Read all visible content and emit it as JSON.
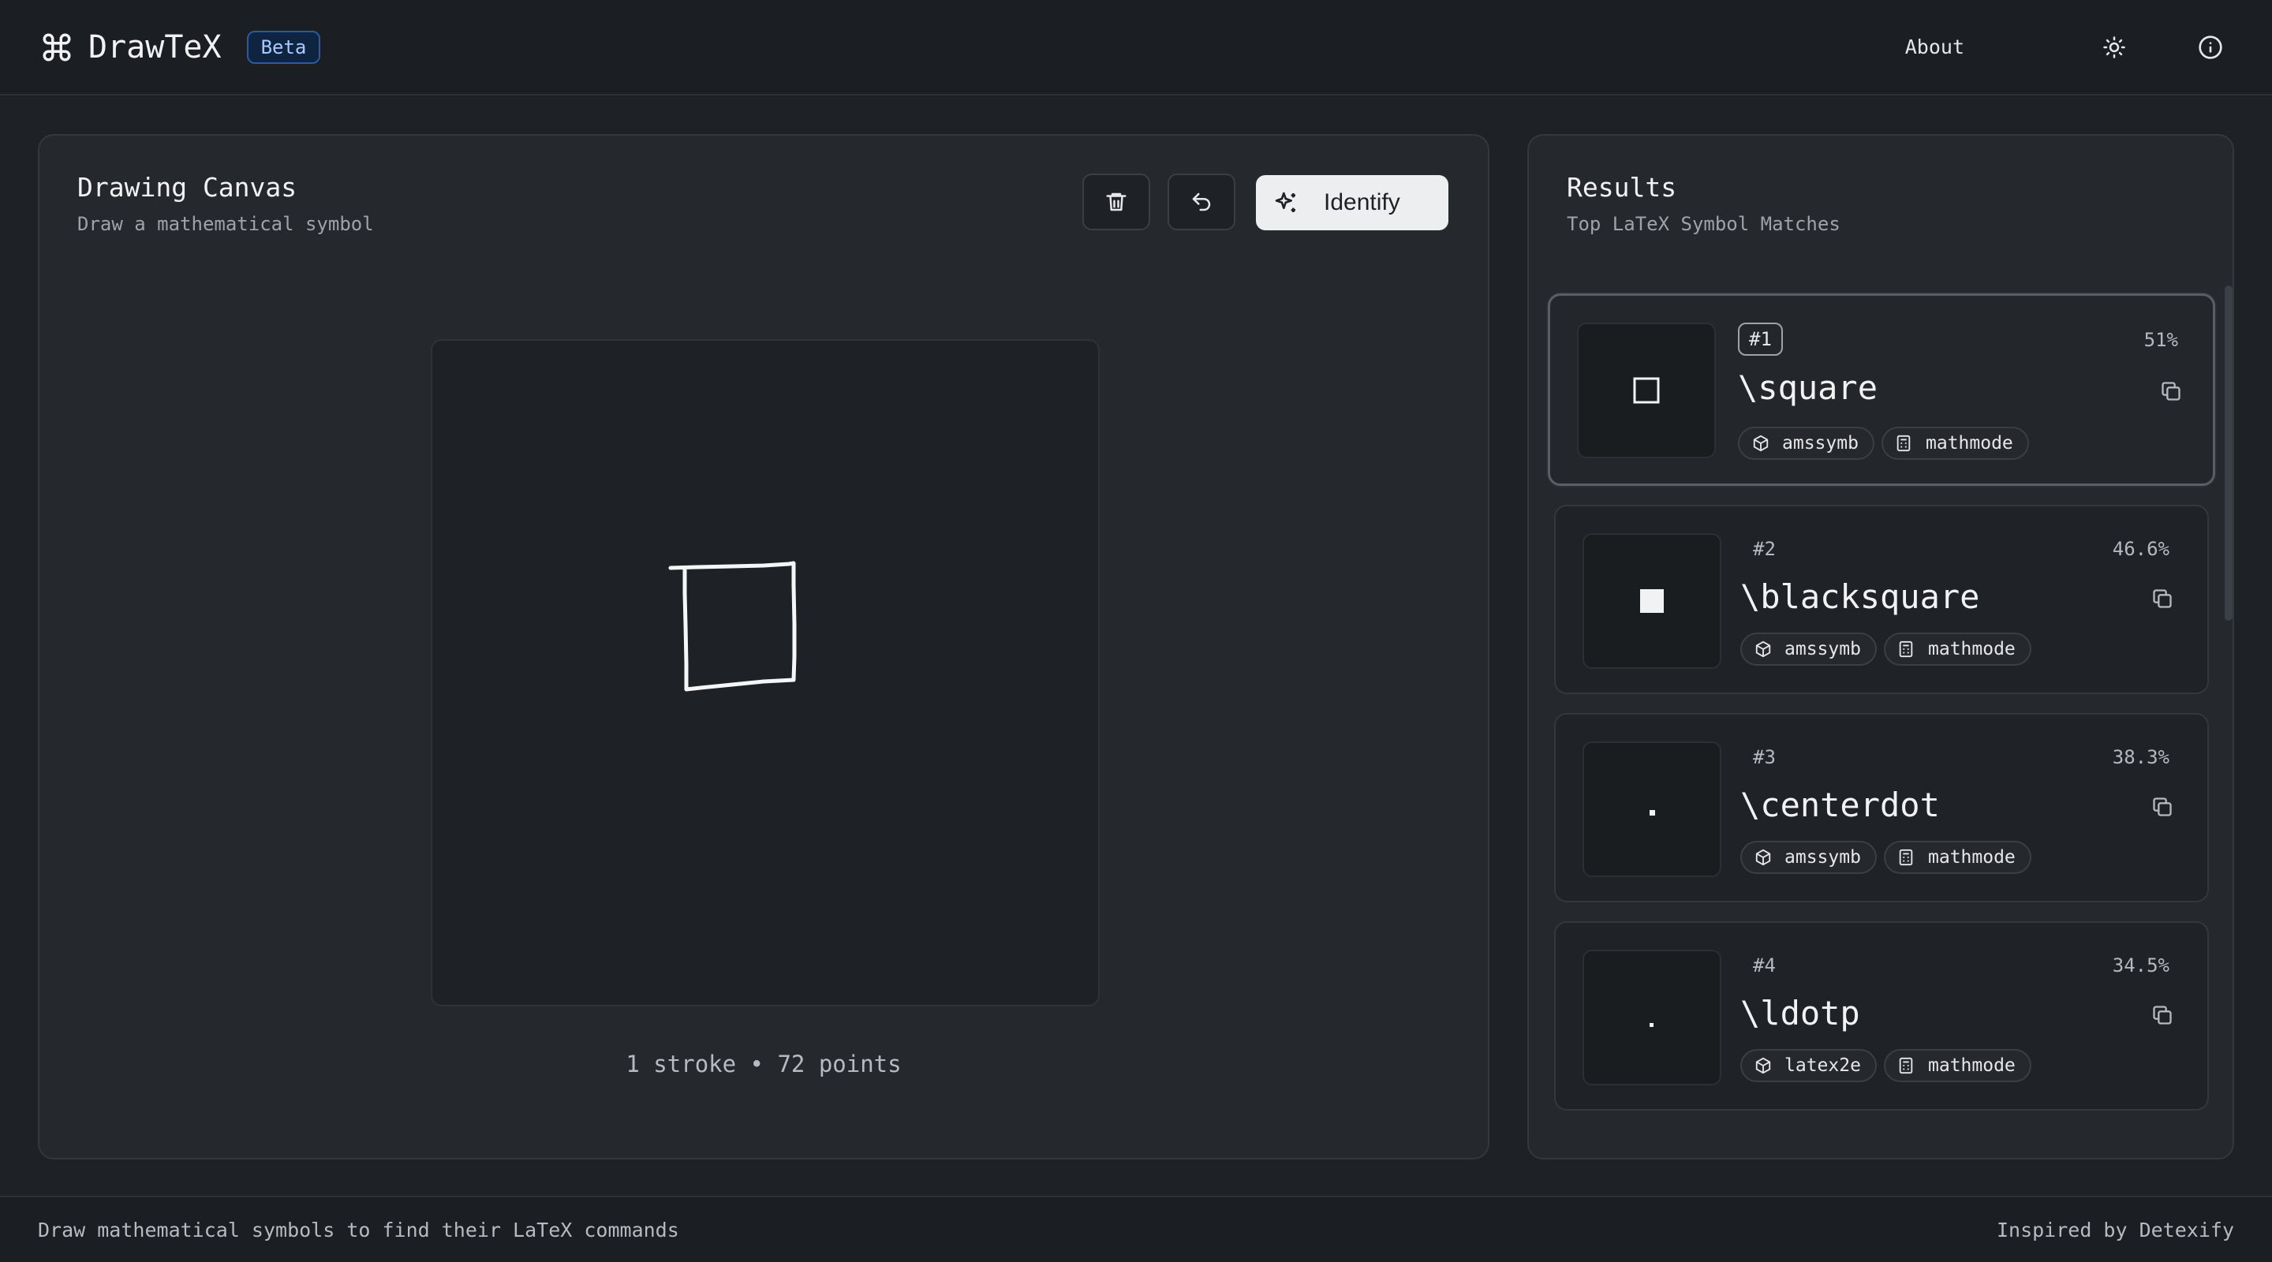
{
  "header": {
    "app_name": "DrawTeX",
    "badge": "Beta",
    "about_label": "About",
    "icons": [
      "command-icon",
      "sun-icon",
      "info-icon"
    ]
  },
  "canvas_panel": {
    "title": "Drawing Canvas",
    "subtitle": "Draw a mathematical symbol",
    "identify_label": "Identify",
    "stroke_info": "1 stroke • 72 points"
  },
  "results_panel": {
    "title": "Results",
    "subtitle": "Top LaTeX Symbol Matches",
    "items": [
      {
        "rank": "#1",
        "percent": "51%",
        "command": "\\square",
        "package": "amssymb",
        "mode": "mathmode",
        "glyph": "□"
      },
      {
        "rank": "#2",
        "percent": "46.6%",
        "command": "\\blacksquare",
        "package": "amssymb",
        "mode": "mathmode",
        "glyph": "■"
      },
      {
        "rank": "#3",
        "percent": "38.3%",
        "command": "\\centerdot",
        "package": "amssymb",
        "mode": "mathmode",
        "glyph": "·"
      },
      {
        "rank": "#4",
        "percent": "34.5%",
        "command": "\\ldotp",
        "package": "latex2e",
        "mode": "mathmode",
        "glyph": "."
      }
    ]
  },
  "footer": {
    "left": "Draw mathematical symbols to find their LaTeX commands",
    "right": "Inspired by Detexify"
  },
  "colors": {
    "background": "#1e2125",
    "panel": "#25292e",
    "accent_badge": "#2a5aa0"
  }
}
